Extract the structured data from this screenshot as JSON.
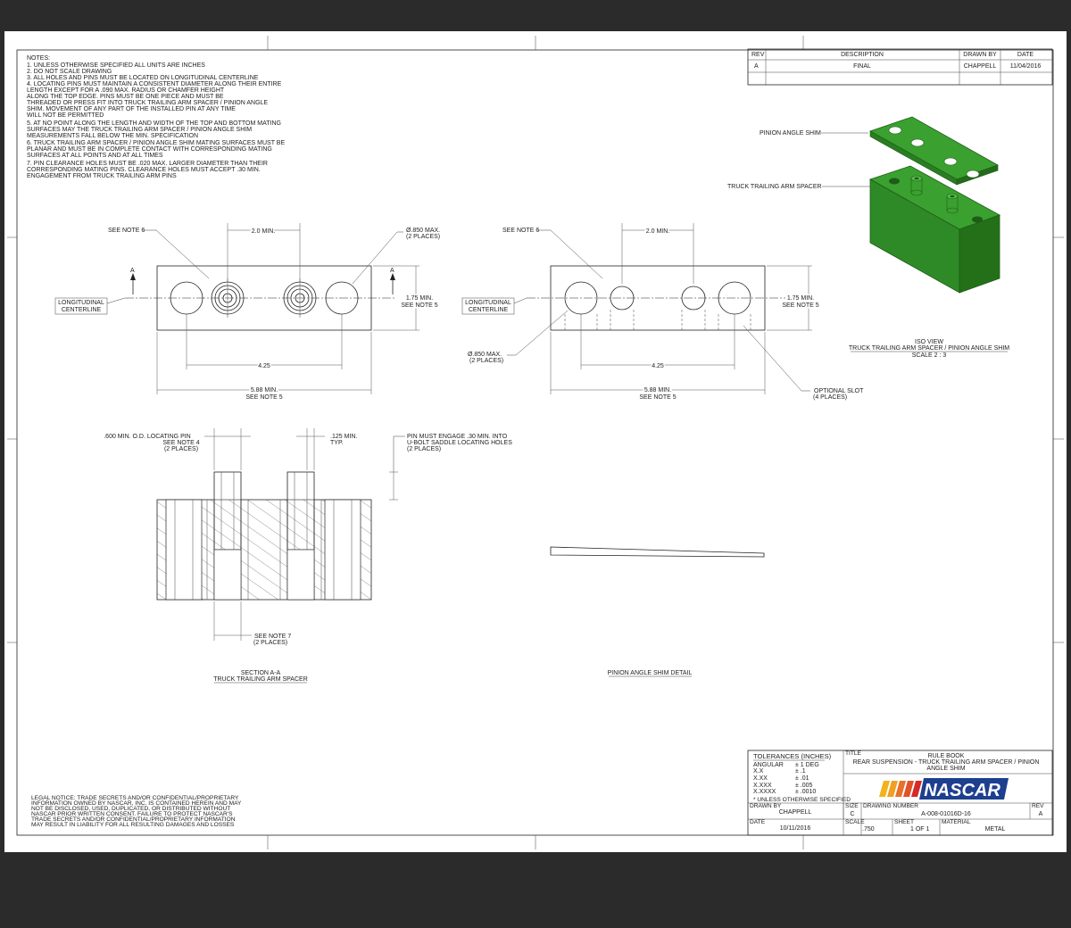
{
  "notes": {
    "title": "NOTES:",
    "lines": [
      "1. UNLESS OTHERWISE SPECIFIED ALL UNITS ARE INCHES",
      "2. DO NOT SCALE DRAWING",
      "3. ALL HOLES AND PINS MUST BE LOCATED ON LONGITUDINAL CENTERLINE",
      "4. LOCATING PINS MUST MAINTAIN A CONSISTENT DIAMETER ALONG THEIR ENTIRE",
      "    LENGTH EXCEPT FOR A .090 MAX. RADIUS OR CHAMFER HEIGHT",
      "    ALONG THE TOP EDGE. PINS MUST BE ONE PIECE AND MUST BE",
      "    THREADED OR PRESS FIT INTO TRUCK TRAILING ARM SPACER / PINION ANGLE",
      "    SHIM. MOVEMENT OF ANY PART OF THE INSTALLED PIN AT ANY TIME",
      "    WILL NOT BE PERMITTED",
      "5. AT NO POINT ALONG THE LENGTH AND WIDTH OF THE TOP AND BOTTOM MATING",
      "    SURFACES MAY THE TRUCK TRAILING ARM SPACER / PINION ANGLE SHIM",
      "    MEASUREMENTS FALL BELOW THE MIN. SPECIFICATION",
      "6. TRUCK TRAILING ARM SPACER / PINION ANGLE SHIM MATING SURFACES MUST BE",
      "    PLANAR AND MUST BE IN COMPLETE CONTACT WITH CORRESPONDING MATING",
      "    SURFACES AT ALL POINTS AND AT ALL TIMES",
      "7. PIN CLEARANCE HOLES MUST BE .020 MAX. LARGER DIAMETER THAN THEIR",
      "    CORRESPONDING MATING PINS. CLEARANCE HOLES MUST ACCEPT .30 MIN.",
      "    ENGAGEMENT FROM TRUCK TRAILING ARM PINS"
    ]
  },
  "revision_block": {
    "headers": [
      "REV",
      "DESCRIPTION",
      "DRAWN BY",
      "DATE"
    ],
    "rows": [
      [
        "A",
        "FINAL",
        "CHAPPELL",
        "11/04/2016"
      ]
    ]
  },
  "views": {
    "left": {
      "see_note_6": "SEE NOTE 6",
      "dim_2_0": "2.0 MIN.",
      "hole_dia_1": "Ø.850 MAX.",
      "hole_dia_2": "(2 PLACES)",
      "section_mark": "A",
      "longitudinal_1": "LONGITUDINAL",
      "longitudinal_2": "CENTERLINE",
      "dim_1_75": "1.75 MIN.",
      "see_note_5": "SEE NOTE 5",
      "dim_4_25": "4.25",
      "dim_5_88": "5.88 MIN.",
      "see_note_5b": "SEE NOTE 5"
    },
    "right": {
      "see_note_6": "SEE NOTE 6",
      "dim_2_0": "2.0 MIN.",
      "longitudinal_1": "LONGITUDINAL",
      "longitudinal_2": "CENTERLINE",
      "dim_1_75": "1.75 MIN.",
      "see_note_5": "SEE NOTE 5",
      "hole_dia_1": "Ø.850 MAX.",
      "hole_dia_2": "(2 PLACES)",
      "dim_4_25": "4.25",
      "dim_5_88": "5.88 MIN.",
      "see_note_5b": "SEE NOTE 5",
      "optional_slot_1": "OPTIONAL SLOT",
      "optional_slot_2": "(4 PLACES)"
    },
    "section": {
      "pin_label_1": ".600 MIN. O.D. LOCATING PIN",
      "pin_label_2": "SEE NOTE 4",
      "pin_label_3": "(2 PLACES)",
      "dim_125_1": ".125 MIN.",
      "dim_125_2": "TYP.",
      "engage_1": "PIN MUST ENGAGE .30 MIN. INTO",
      "engage_2": "U-BOLT SADDLE LOCATING HOLES",
      "engage_3": "(2 PLACES)",
      "see_note_7": "SEE NOTE 7",
      "see_note_7b": "(2 PLACES)",
      "caption_1": "SECTION A-A",
      "caption_2": "TRUCK TRAILING ARM SPACER"
    },
    "shim_detail": {
      "caption": "PINION ANGLE SHIM DETAIL"
    },
    "iso": {
      "pinion_label": "PINION ANGLE SHIM",
      "spacer_label": "TRUCK TRAILING ARM SPACER",
      "caption_1": "ISO VIEW",
      "caption_2": "TRUCK TRAILING ARM SPACER / PINION ANGLE SHIM",
      "caption_3": "SCALE 2 : 3",
      "color": "#3aa02f"
    }
  },
  "legal": {
    "lines": [
      "LEGAL NOTICE:  TRADE SECRETS AND/OR CONFIDENTIAL/PROPRIETARY",
      "INFORMATION OWNED BY NASCAR, INC. IS CONTAINED HEREIN AND MAY",
      "NOT BE DISCLOSED, USED, DUPLICATED, OR DISTRIBUTED WITHOUT",
      "NASCAR PRIOR WRITTEN CONSENT.  FAILURE TO PROTECT NASCAR'S",
      "TRADE SECRETS AND/OR CONFIDENTIAL/PROPRIETARY INFORMATION",
      "MAY RESULT IN LIABILITY FOR ALL RESULTING DAMAGES AND LOSSES"
    ]
  },
  "title_block": {
    "tolerances_title": "TOLERANCES (INCHES)",
    "tolerances": [
      {
        "label": "ANGULAR",
        "value": "± 1 DEG"
      },
      {
        "label": "X.X",
        "value": "± .1"
      },
      {
        "label": "X.XX",
        "value": "± .01"
      },
      {
        "label": "X.XXX",
        "value": "± .005"
      },
      {
        "label": "X.XXXX",
        "value": "± .0010"
      }
    ],
    "unless": "* UNLESS OTHERWISE SPECIFIED",
    "title_label": "TITLE",
    "title_1": "RULE BOOK",
    "title_2": "REAR SUSPENSION - TRUCK TRAILING ARM SPACER / PINION",
    "title_3": "ANGLE SHIM",
    "logo_text": "NASCAR",
    "logo_colors": [
      "#f2b21c",
      "#e8702a",
      "#d42a2a",
      "#1d3f8f"
    ],
    "drawn_by_label": "DRAWN BY",
    "drawn_by": "CHAPPELL",
    "date_label": "DATE",
    "date": "10/11/2016",
    "size_label": "SIZE",
    "size": "C",
    "dwg_label": "DRAWING NUMBER",
    "dwg_number": "A-008-01016D-16",
    "rev_label": "REV",
    "rev": "A",
    "scale_label": "SCALE",
    "scale": ".750",
    "sheet_label": "SHEET",
    "sheet": "1 OF 1",
    "material_label": "MATERIAL",
    "material": "METAL"
  }
}
